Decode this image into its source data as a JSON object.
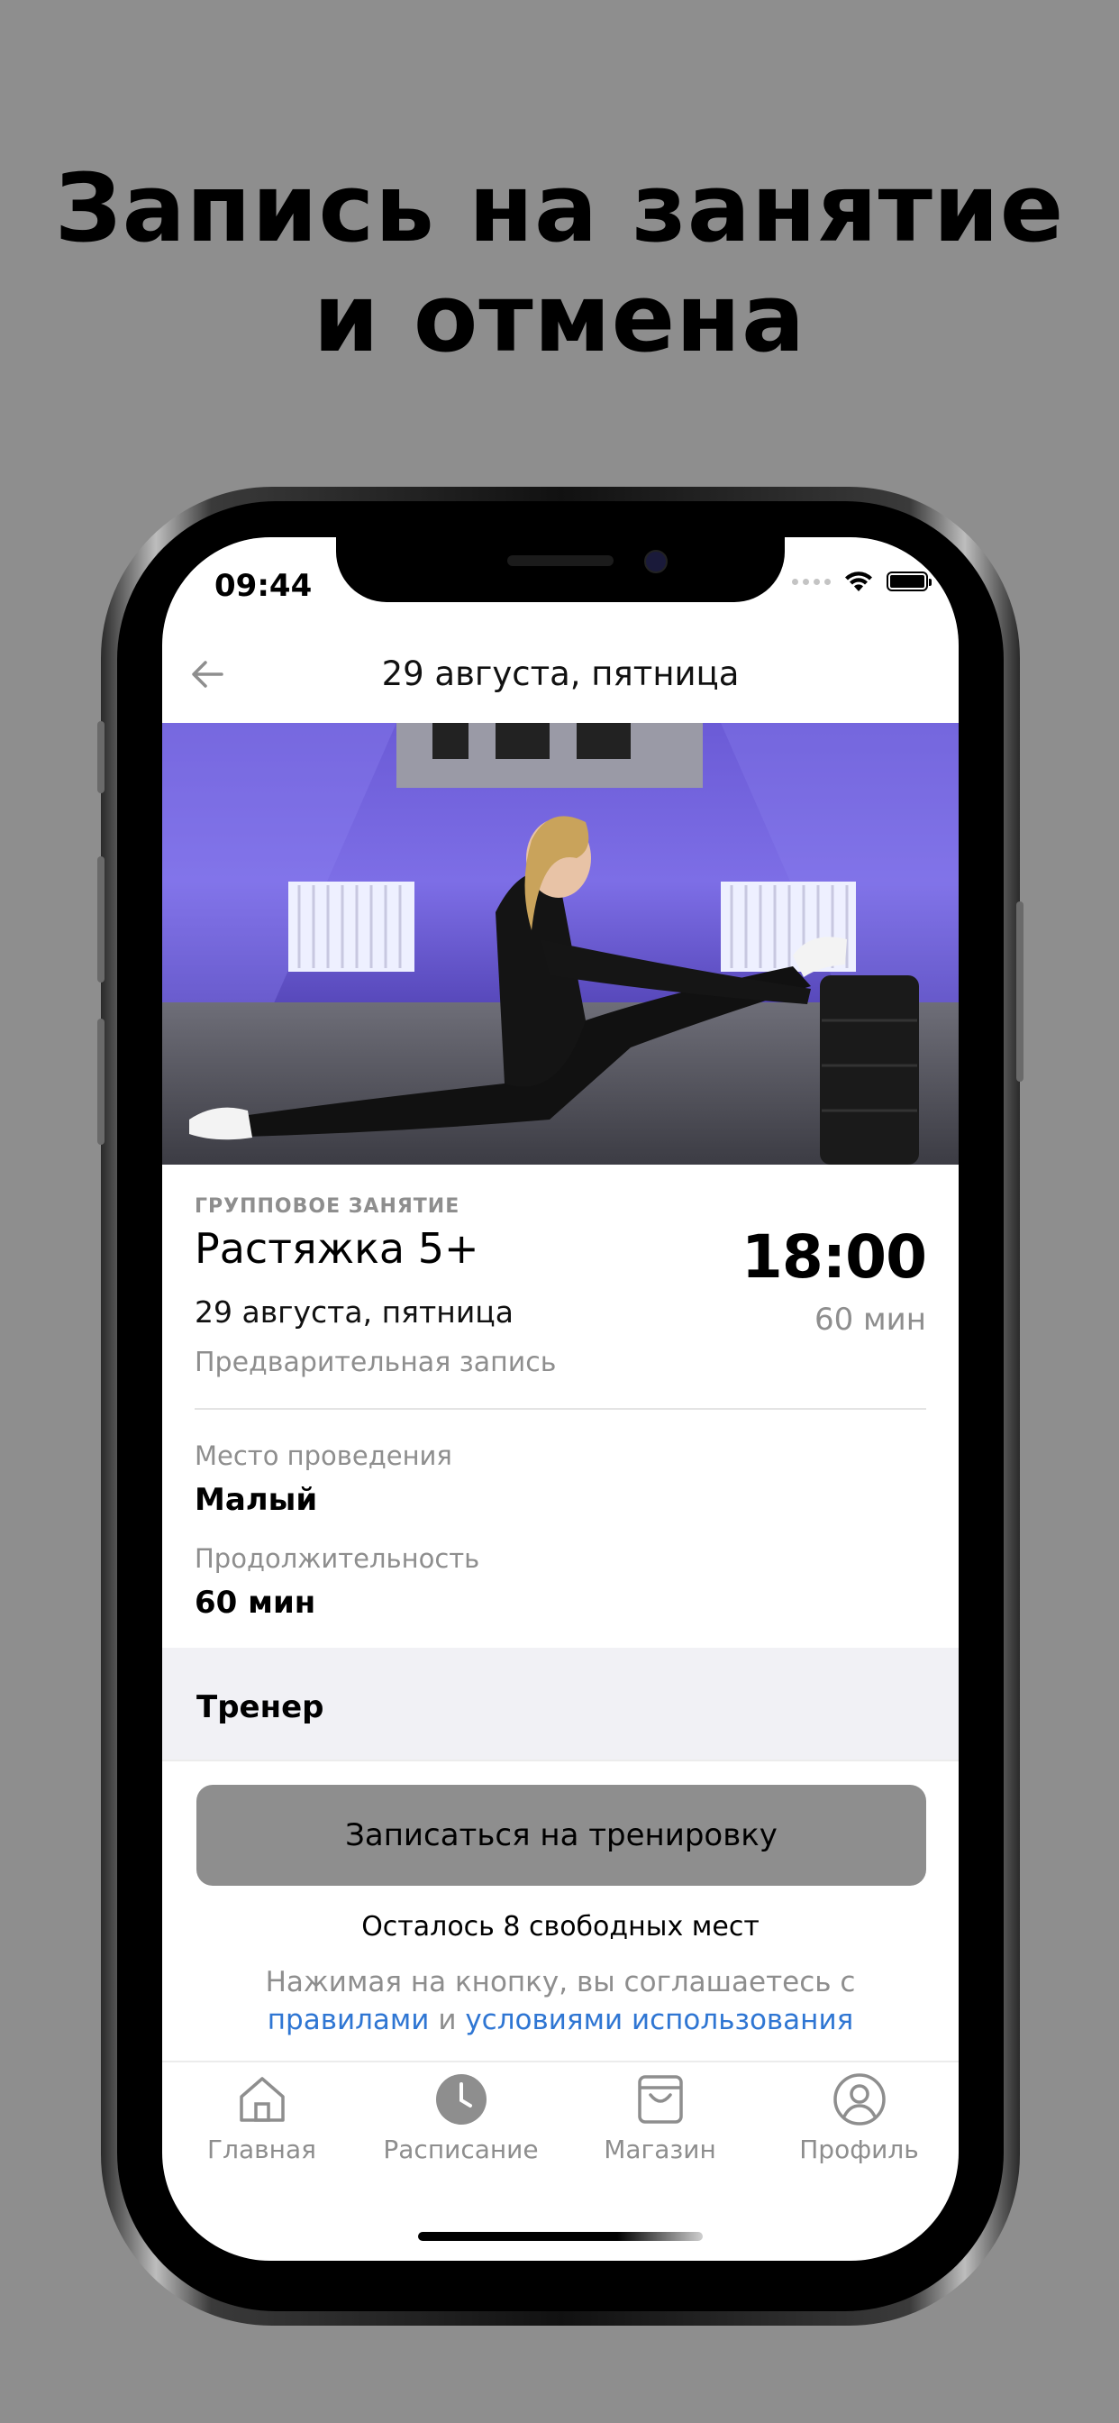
{
  "promo": {
    "line1": "Запись на занятие",
    "line2": "и отмена"
  },
  "status_bar": {
    "time": "09:44"
  },
  "header": {
    "title": "29 августа, пятница",
    "back_icon": "arrow-left-icon"
  },
  "class": {
    "kicker": "ГРУППОВОЕ ЗАНЯТИЕ",
    "name": "Растяжка 5+",
    "date": "29 августа, пятница",
    "note": "Предварительная запись",
    "time": "18:00",
    "duration_short": "60 мин"
  },
  "details": {
    "location_label": "Место проведения",
    "location_value": "Малый",
    "duration_label": "Продолжительность",
    "duration_value": "60 мин"
  },
  "trainer": {
    "label": "Тренер"
  },
  "signup": {
    "button_label": "Записаться на тренировку",
    "seats_text": "Осталось 8 свободных мест",
    "terms_prefix": "Нажимая на кнопку, вы соглашаетесь с",
    "terms_rules_link": "правилами",
    "terms_and": "и",
    "terms_conditions_link": "условиями использования"
  },
  "tabbar": {
    "items": [
      {
        "label": "Главная",
        "icon": "home-icon"
      },
      {
        "label": "Расписание",
        "icon": "clock-icon"
      },
      {
        "label": "Магазин",
        "icon": "shopping-bag-icon"
      },
      {
        "label": "Профиль",
        "icon": "user-circle-icon"
      }
    ]
  },
  "colors": {
    "accent_link": "#2f76d3",
    "button_bg": "#8e8e8e",
    "background": "#8e8e8e"
  }
}
